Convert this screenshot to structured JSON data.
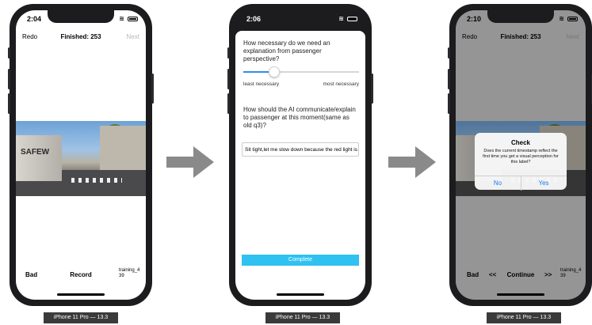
{
  "phones": [
    {
      "time": "2:04",
      "nav": {
        "left": "Redo",
        "title": "Finished: 253",
        "right": "Next"
      },
      "image": {
        "truck_text": "SAFEW"
      },
      "bottom": {
        "left": "Bad",
        "center": "Record",
        "right": "training_439"
      },
      "device_label": "iPhone 11 Pro — 13.3"
    },
    {
      "time": "2:06",
      "q1": "How necessary do we need an explanation from passenger perspective?",
      "slider": {
        "min_label": "least necessary",
        "max_label": "most necessary",
        "value": 0.27
      },
      "q2": "How should the AI communicate/explain to passenger at this moment(same as old q3)?",
      "answer": "Sit tight,let me slow down because the red light is on",
      "complete": "Complete",
      "device_label": "iPhone 11 Pro — 13.3"
    },
    {
      "time": "2:10",
      "nav": {
        "left": "Redo",
        "title": "Finished: 253",
        "right": "Next"
      },
      "dialog": {
        "title": "Check",
        "message": "Does the current timestamp reflect the first time you get a visual perception for this label?",
        "no": "No",
        "yes": "Yes"
      },
      "bottom": {
        "bad": "Bad",
        "prev": "<<",
        "continue": "Continue",
        "next": ">>",
        "right": "training_439"
      },
      "device_label": "iPhone 11 Pro — 13.3"
    }
  ],
  "colors": {
    "accent": "#2f8cf0",
    "complete_button": "#2fc1ef",
    "arrow": "#8a8a8a"
  }
}
